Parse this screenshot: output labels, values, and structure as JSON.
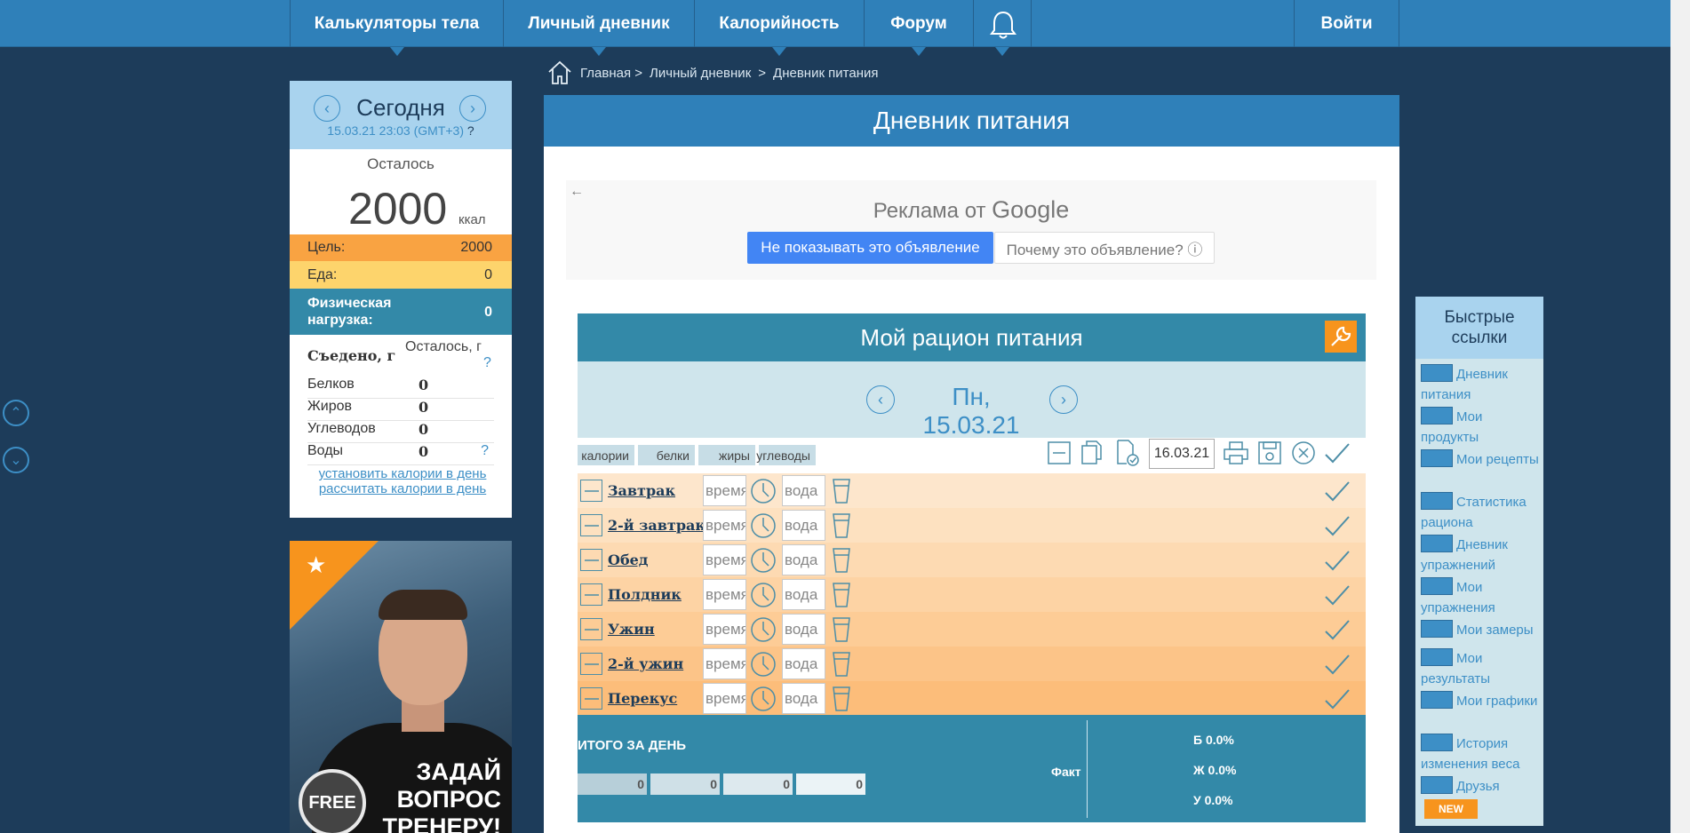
{
  "nav": {
    "items": [
      "Калькуляторы тела",
      "Личный дневник",
      "Калорийность",
      "Форум"
    ],
    "login": "Войти"
  },
  "breadcrumb": {
    "home": "Главная >",
    "diary": "Личный дневник",
    "sep": ">",
    "current": "Дневник питания"
  },
  "today": {
    "title": "Сегодня",
    "datetime": "15.03.21 23:03 (GMT+3)",
    "help": "?",
    "remaining_label": "Осталось",
    "remaining_value": "2000",
    "remaining_unit": "ккал",
    "goal_label": "Цель:",
    "goal_value": "2000",
    "food_label": "Еда:",
    "food_value": "0",
    "exercise_label": "Физическая нагрузка:",
    "exercise_value": "0",
    "eaten_label": "Съедено, г",
    "eaten_remaining": "Осталось, г",
    "eaten_help": "?",
    "nutrients": [
      {
        "label": "Белков",
        "value": "0"
      },
      {
        "label": "Жиров",
        "value": "0"
      },
      {
        "label": "Углеводов",
        "value": "0"
      },
      {
        "label": "Воды",
        "value": "0"
      }
    ],
    "water_help": "?",
    "link_set": "установить калории в день",
    "link_calc": "рассчитать калории в день"
  },
  "promo": {
    "text_line1": "ЗАДАЙ",
    "text_line2": "ВОПРОС",
    "text_line3": "ТРЕНЕРУ!",
    "badge": "FREE"
  },
  "main": {
    "title": "Дневник питания",
    "ad": {
      "back": "←",
      "title_prefix": "Реклама от ",
      "title_brand": "Google",
      "btn_hide": "Не показывать это объявление",
      "btn_why": "Почему это объявление? ⓘ"
    },
    "ration": {
      "title": "Мой рацион питания",
      "date": "Пн, 15.03.21",
      "chips": [
        "калории",
        "белки",
        "жиры",
        "углеводы"
      ],
      "copy_date": "16.03.21",
      "meals": [
        {
          "name": "Завтрак",
          "time_placeholder": "время",
          "water_placeholder": "вода"
        },
        {
          "name": "2-й завтрак",
          "time_placeholder": "время",
          "water_placeholder": "вода"
        },
        {
          "name": "Обед",
          "time_placeholder": "время",
          "water_placeholder": "вода"
        },
        {
          "name": "Полдник",
          "time_placeholder": "время",
          "water_placeholder": "вода"
        },
        {
          "name": "Ужин",
          "time_placeholder": "время",
          "water_placeholder": "вода"
        },
        {
          "name": "2-й ужин",
          "time_placeholder": "время",
          "water_placeholder": "вода"
        },
        {
          "name": "Перекус",
          "time_placeholder": "время",
          "water_placeholder": "вода"
        }
      ],
      "totals": {
        "title": "ИТОГО ЗА ДЕНЬ",
        "values": [
          "0",
          "0",
          "0",
          "0"
        ],
        "fact_label": "Факт",
        "protein_pct": "Б 0.0%",
        "fat_pct": "Ж 0.0%",
        "carb_pct": "У 0.0%"
      }
    }
  },
  "quick_links": {
    "title": "Быстрые ссылки",
    "items": [
      "Дневник питания",
      "Мои продукты",
      "Мои рецепты",
      "Статистика рациона",
      "Дневник упражнений",
      "Мои упражнения",
      "Мои замеры",
      "Мои результаты",
      "Мои графики",
      "История изменения веса",
      "Друзья"
    ],
    "new_badge": "NEW"
  },
  "colors": {
    "nav_bg": "#2f80b9",
    "page_bg": "#1d3c5a",
    "accent_orange": "#f7941d",
    "teal": "#3389a8",
    "meal_rows": [
      "#fde6cc",
      "#fde1c0",
      "#fddab2",
      "#fdd3a4",
      "#fdcc96",
      "#fcc488",
      "#fcbd7a"
    ]
  }
}
